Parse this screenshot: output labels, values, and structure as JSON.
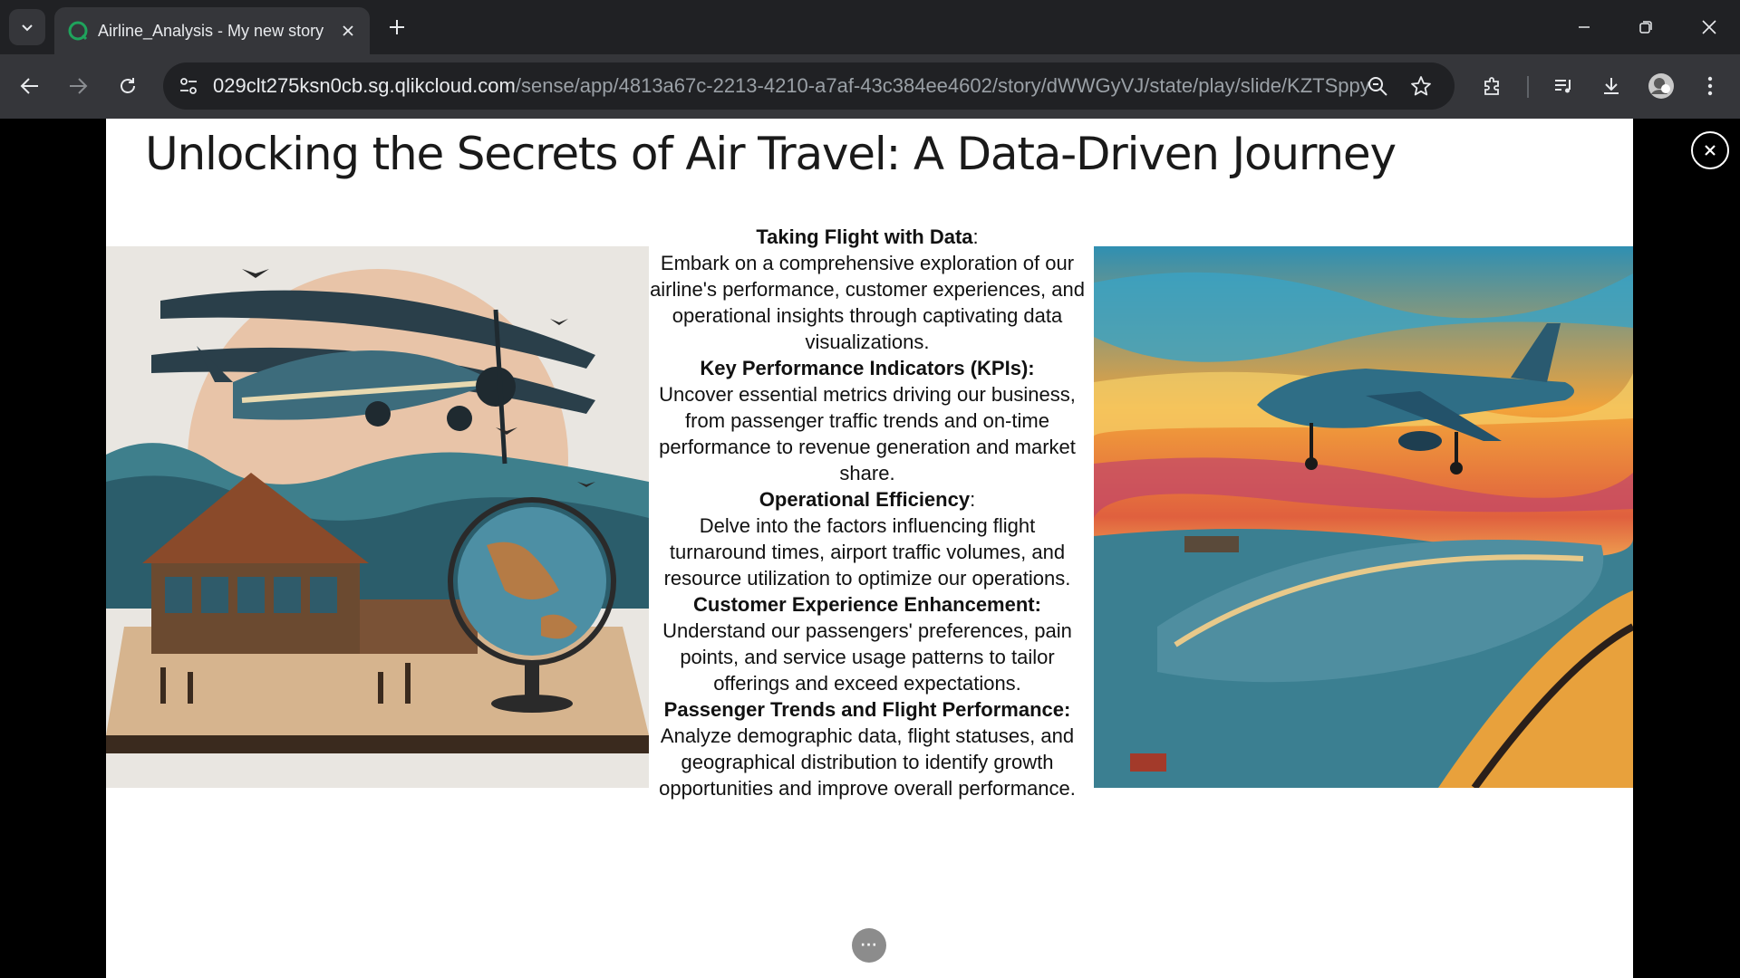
{
  "browser": {
    "tab": {
      "title": "Airline_Analysis - My new story"
    },
    "address": {
      "host": "029clt275ksn0cb.sg.qlikcloud.com",
      "path": "/sense/app/4813a67c-2213-4210-a7af-43c384ee4602/story/dWWGyVJ/state/play/slide/KZTSppy"
    },
    "colors": {
      "tabbar": "#202124",
      "toolbar": "#35363a",
      "favicon": "#1fa35c"
    }
  },
  "slide": {
    "title": "Unlocking the Secrets of Air Travel: A Data-Driven Journey",
    "sections": [
      {
        "heading": "Taking Flight with Data",
        "heading_suffix": ":",
        "text": "Embark on a comprehensive exploration of our airline's performance, customer experiences, and operational insights through captivating data visualizations."
      },
      {
        "heading": "Key Performance Indicators (KPIs)",
        "heading_suffix": ":",
        "text": "Uncover essential metrics driving our business, from passenger traffic trends and on-time performance to revenue generation and market share."
      },
      {
        "heading": "Operational Efficiency",
        "heading_suffix": ":",
        "text": "Delve into the factors influencing flight turnaround times, airport traffic volumes, and resource utilization to optimize our operations."
      },
      {
        "heading": "Customer Experience Enhancement:",
        "heading_suffix": "",
        "text": "Understand our passengers' preferences, pain points, and service usage patterns to tailor offerings and exceed expectations."
      },
      {
        "heading": "Passenger Trends and Flight Performance:",
        "heading_suffix": "",
        "text": "Analyze demographic data, flight statuses, and geographical distribution to identify growth opportunities and improve overall performance."
      }
    ],
    "more_button": "···"
  }
}
